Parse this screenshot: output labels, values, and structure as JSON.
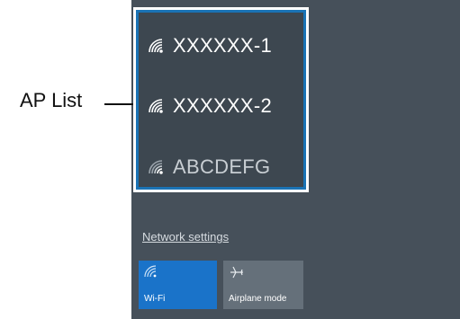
{
  "callout": {
    "label": "AP List"
  },
  "ap_list": {
    "items": [
      {
        "name": "XXXXXX-1",
        "icon": "wifi-signal-icon"
      },
      {
        "name": "XXXXXX-2",
        "icon": "wifi-signal-icon"
      },
      {
        "name": "ABCDEFG",
        "icon": "wifi-signal-icon"
      }
    ]
  },
  "network_settings_label": "Network settings",
  "quick_actions": {
    "wifi": {
      "label": "Wi-Fi",
      "icon": "wifi-icon",
      "state": "on"
    },
    "airplane": {
      "label": "Airplane mode",
      "icon": "airplane-icon",
      "state": "off"
    }
  },
  "colors": {
    "panel_bg": "#46505a",
    "accent": "#1a73c9",
    "highlight_border": "#1a73b5",
    "tile_off": "#65707a"
  }
}
